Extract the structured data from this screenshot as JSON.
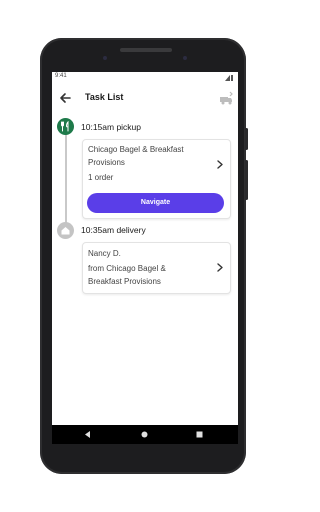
{
  "status_bar": {
    "time": "9:41"
  },
  "app_bar": {
    "title": "Task List"
  },
  "stops": [
    {
      "heading": "10:15am pickup",
      "lines": [
        "Chicago Bagel & Breakfast",
        "Provisions",
        "1 order"
      ],
      "button_label": "Navigate"
    },
    {
      "heading": "10:35am delivery",
      "lines": [
        "Nancy D.",
        "from Chicago Bagel &",
        "Breakfast Provisions"
      ]
    }
  ],
  "colors": {
    "pickup_pin": "#1e7a4a",
    "delivery_pin": "#c4c4c4",
    "button": "#5a3ee8"
  },
  "icons": [
    "back-arrow-icon",
    "truck-icon",
    "fork-knife-icon",
    "house-icon",
    "chevron-right-icon",
    "signal-icon",
    "battery-icon",
    "nav-back-icon",
    "nav-home-icon",
    "nav-recents-icon"
  ]
}
